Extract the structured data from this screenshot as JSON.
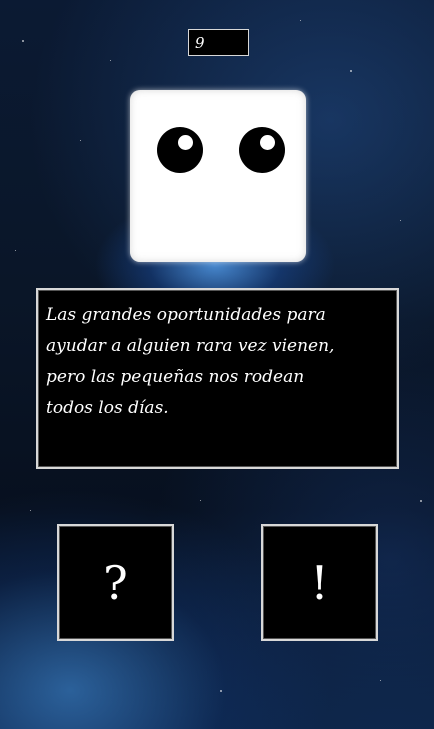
{
  "counter": {
    "value": "9"
  },
  "character": {
    "eyes": "open"
  },
  "dialog": {
    "text": "Las grandes oportunidades para\nayudar a alguien rara vez vienen,\npero las pequeñas nos rodean\ntodos los días."
  },
  "choices": {
    "question_label": "?",
    "exclaim_label": "!"
  },
  "colors": {
    "background": "#0a1628",
    "glow": "#5aaaff",
    "panel": "#000000",
    "border": "#d8d8d8",
    "text": "#ffffff"
  }
}
